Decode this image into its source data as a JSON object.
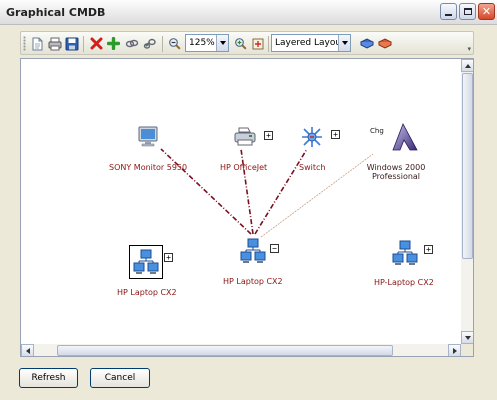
{
  "window": {
    "title": "Graphical CMDB"
  },
  "toolbar": {
    "zoom_value": "125%",
    "layout_value": "Layered Layout",
    "icons": [
      "new-document-icon",
      "print-icon",
      "save-icon",
      "delete-icon",
      "add-icon",
      "link-icon",
      "unlink-icon",
      "zoom-out-icon",
      "zoom-in-icon",
      "fit-icon",
      "book-blue-icon",
      "book-red-icon"
    ]
  },
  "graph": {
    "nodes": [
      {
        "id": "monitor",
        "label": "SONY Monitor 5950",
        "icon": "monitor-icon"
      },
      {
        "id": "printer",
        "label": "HP OfficeJet",
        "icon": "printer-icon",
        "expand": "+"
      },
      {
        "id": "switch",
        "label": "Switch",
        "icon": "switch-icon",
        "expand": "+"
      },
      {
        "id": "windows",
        "label_line1": "Windows 2000",
        "label_line2": "Professional",
        "icon": "os-icon",
        "badge": "Chg"
      },
      {
        "id": "laptop-left",
        "label": "HP Laptop CX2",
        "icon": "network-icon",
        "expand": "+"
      },
      {
        "id": "laptop-center",
        "label": "HP Laptop CX2",
        "icon": "network-icon",
        "expand": "−"
      },
      {
        "id": "laptop-right",
        "label": "HP-Laptop CX2",
        "icon": "network-icon",
        "expand": "+"
      }
    ],
    "edge_colors": {
      "strong": "#7a1020",
      "weak": "#c9a08a"
    }
  },
  "buttons": {
    "refresh": "Refresh",
    "cancel": "Cancel"
  }
}
